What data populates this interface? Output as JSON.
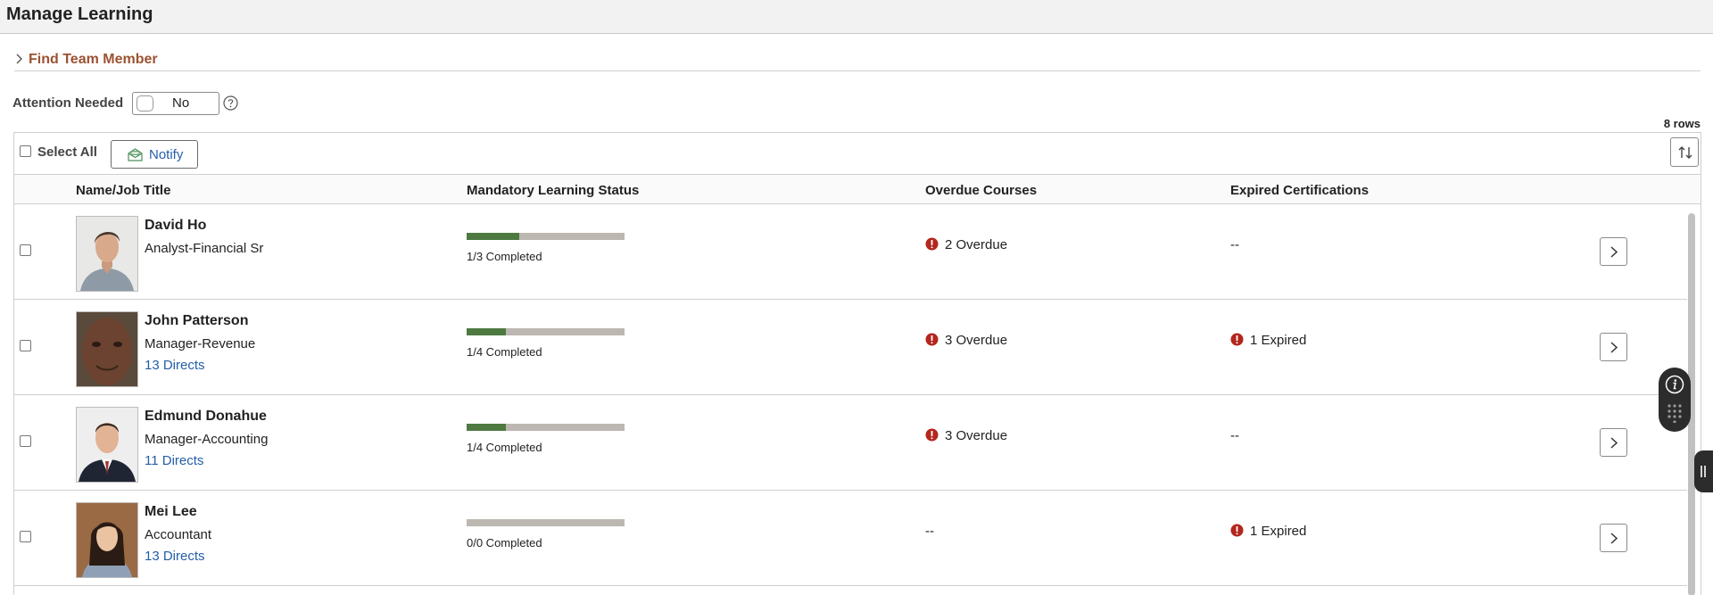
{
  "page": {
    "title": "Manage Learning"
  },
  "find": {
    "label": "Find Team Member"
  },
  "filter": {
    "label": "Attention Needed",
    "toggle_value": "No"
  },
  "grid": {
    "row_count": "8 rows",
    "select_all_label": "Select All",
    "notify_label": "Notify",
    "columns": {
      "name": "Name/Job Title",
      "status": "Mandatory Learning Status",
      "overdue": "Overdue Courses",
      "expired": "Expired Certifications"
    },
    "rows": [
      {
        "name": "David Ho",
        "title": "Analyst-Financial Sr",
        "directs": "",
        "progress_text": "1/3 Completed",
        "progress_fraction": 0.333,
        "overdue": "2 Overdue",
        "overdue_alert": true,
        "expired": "--",
        "expired_alert": false
      },
      {
        "name": "John Patterson",
        "title": "Manager-Revenue",
        "directs": "13 Directs",
        "progress_text": "1/4 Completed",
        "progress_fraction": 0.25,
        "overdue": "3 Overdue",
        "overdue_alert": true,
        "expired": "1 Expired",
        "expired_alert": true
      },
      {
        "name": "Edmund Donahue",
        "title": "Manager-Accounting",
        "directs": "11 Directs",
        "progress_text": "1/4 Completed",
        "progress_fraction": 0.25,
        "overdue": "3 Overdue",
        "overdue_alert": true,
        "expired": "--",
        "expired_alert": false
      },
      {
        "name": "Mei Lee",
        "title": "Accountant",
        "directs": "13 Directs",
        "progress_text": "0/0 Completed",
        "progress_fraction": 0,
        "overdue": "--",
        "overdue_alert": false,
        "expired": "1 Expired",
        "expired_alert": true
      }
    ]
  },
  "colors": {
    "link": "#245ea8",
    "section_header": "#9c5232",
    "progress_fill": "#4e7a41",
    "progress_track": "#bcb7b1",
    "alert": "#b3261e"
  },
  "icons": {
    "find_chevron": "chevron-right-icon",
    "help": "help-icon",
    "notify": "envelope-icon",
    "sort": "sort-icon",
    "alert": "error-icon",
    "detail": "chevron-right-icon",
    "info": "info-icon",
    "grid_dots": "grid-dots-icon",
    "side_tab": "drag-handle-icon"
  }
}
